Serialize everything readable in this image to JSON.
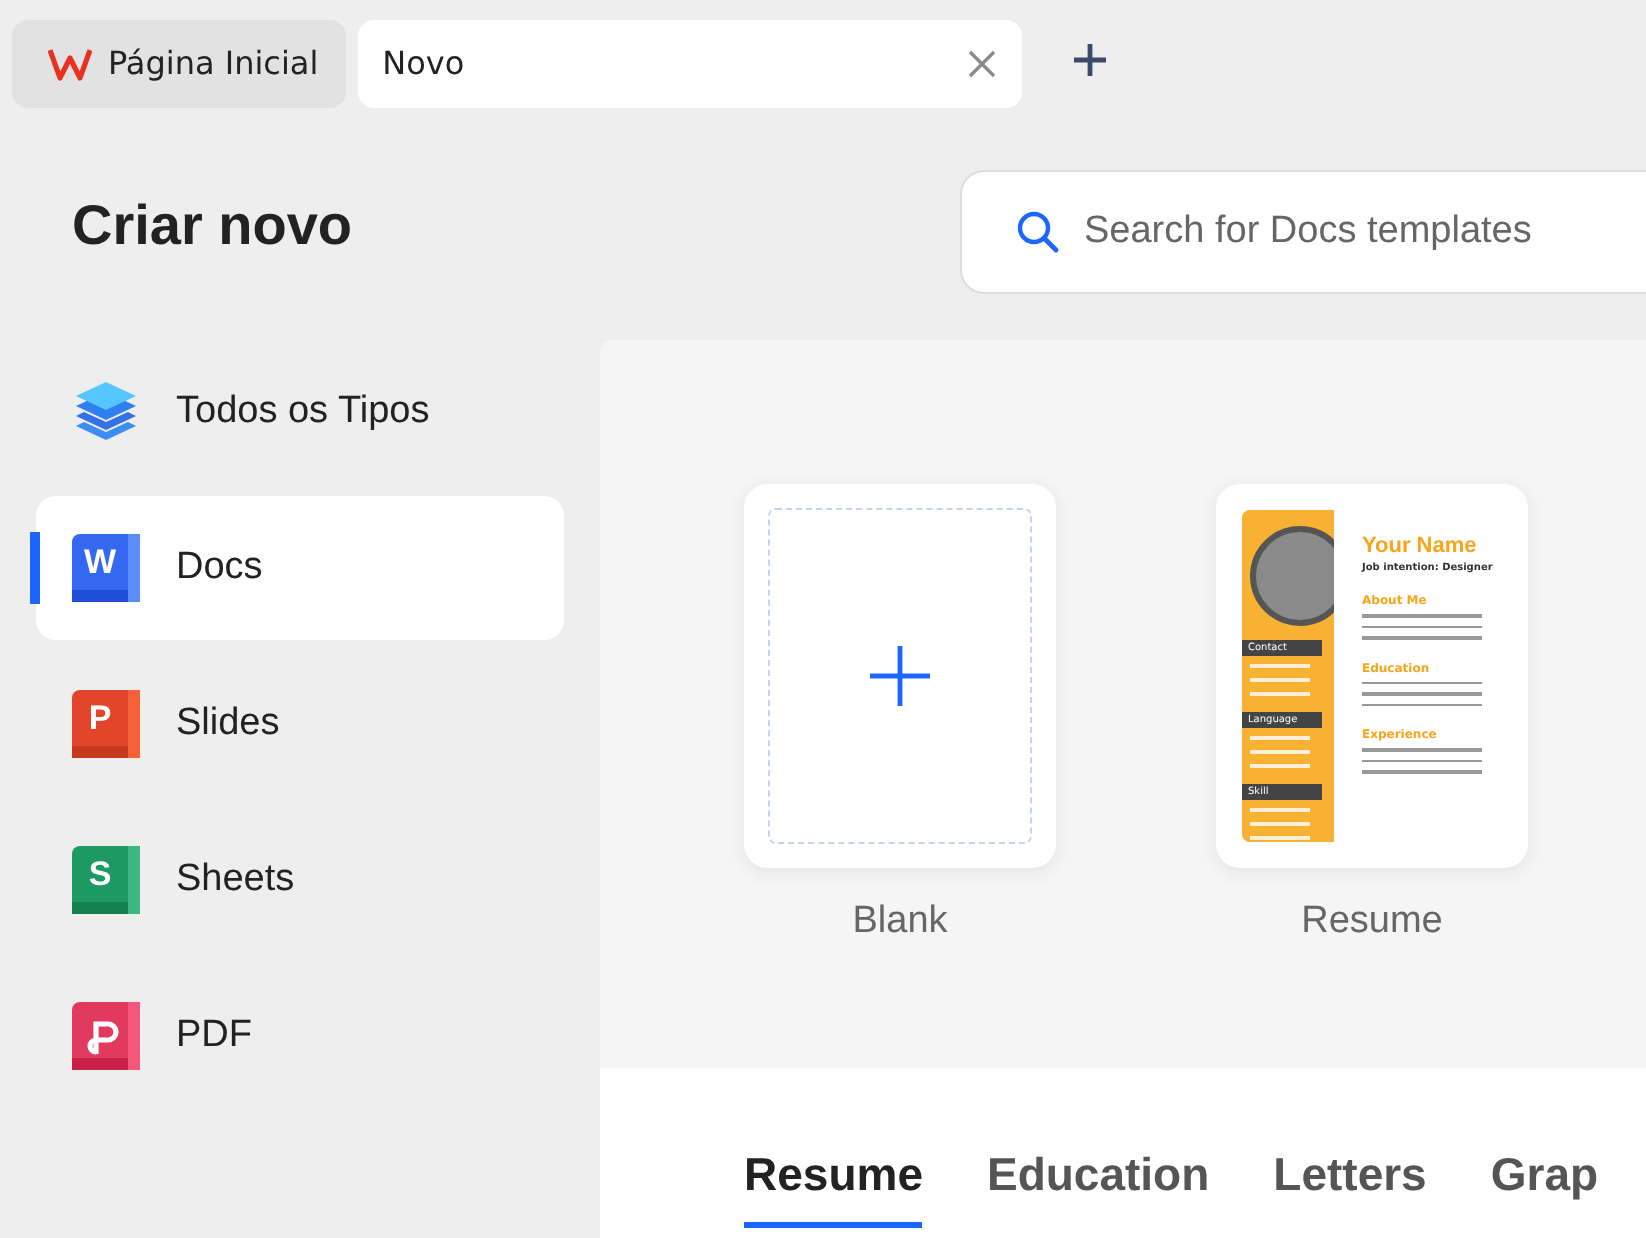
{
  "tabs": [
    {
      "kind": "home",
      "label": "Página Inicial",
      "selected": false
    },
    {
      "kind": "doc",
      "label": "Novo",
      "selected": true
    }
  ],
  "title": "Criar novo",
  "search": {
    "placeholder": "Search for Docs templates"
  },
  "sidebar": {
    "items": [
      {
        "kind": "all",
        "label": "Todos os Tipos",
        "selected": false
      },
      {
        "kind": "docs",
        "icon_letter": "W",
        "label": "Docs",
        "selected": true
      },
      {
        "kind": "slides",
        "icon_letter": "P",
        "label": "Slides",
        "selected": false
      },
      {
        "kind": "sheets",
        "icon_letter": "S",
        "label": "Sheets",
        "selected": false
      },
      {
        "kind": "pdf",
        "label": "PDF",
        "selected": false
      }
    ]
  },
  "templates": [
    {
      "kind": "blank",
      "label": "Blank"
    },
    {
      "kind": "resume",
      "label": "Resume",
      "preview": {
        "name": "Your Name",
        "subtitle": "Job intention: Designer",
        "left_sections": [
          "Contact",
          "Language",
          "Skill"
        ],
        "right_sections": [
          "About Me",
          "Education",
          "Experience"
        ]
      }
    }
  ],
  "categories": [
    {
      "label": "Resume",
      "selected": true
    },
    {
      "label": "Education",
      "selected": false
    },
    {
      "label": "Letters",
      "selected": false
    },
    {
      "label": "Grap",
      "selected": false
    }
  ]
}
